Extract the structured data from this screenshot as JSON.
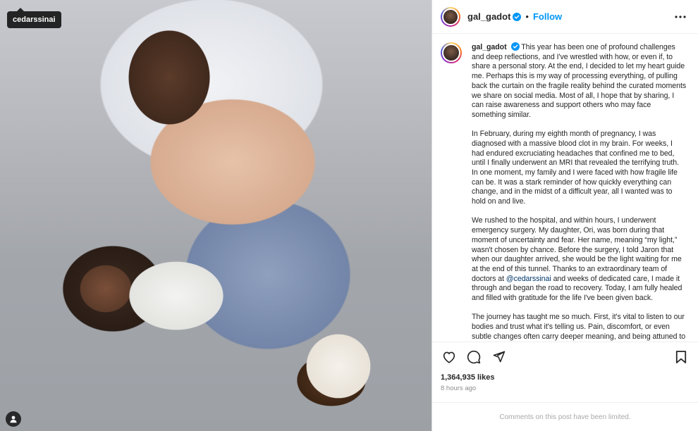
{
  "media": {
    "tag_label": "cedarssinai"
  },
  "header": {
    "username": "gal_gadot",
    "separator": "•",
    "follow_label": "Follow"
  },
  "caption": {
    "username": "gal_gadot",
    "p1": "This year has been one of profound challenges and deep reflections, and I've wrestled with how, or even if, to share a personal story. At the end, I decided to let my heart guide me. Perhaps this is my way of processing everything, of pulling back the curtain on the fragile reality behind the curated moments we share on social media. Most of all, I hope that by sharing, I can raise awareness and support others who may face something similar.",
    "p2": "In February, during my eighth month of pregnancy, I was diagnosed with a massive blood clot in my brain. For weeks, I had endured excruciating headaches that confined me to bed, until I finally underwent an MRI that revealed the terrifying truth. In one moment, my family and I were faced with how fragile life can be. It was a stark reminder of how quickly everything can change, and in the midst of a difficult year, all I wanted was to hold on and live.",
    "p3a": "We rushed to the hospital, and within hours, I underwent emergency surgery. My daughter, Ori, was born during that moment of uncertainty and fear. Her name, meaning “my light,” wasn't chosen by chance. Before the surgery, I told Jaron that when our daughter arrived, she would be the light waiting for me at the end of this tunnel. Thanks to an extraordinary team of doctors at ",
    "p3_mention": "@cedarssinai",
    "p3b": " and weeks of dedicated care, I made it through and began the road to recovery. Today, I am fully healed and filled with gratitude for the life I've been given back.",
    "p4": "The journey has taught me so much. First, it's vital to listen to our bodies and trust what it's telling us. Pain, discomfort, or even subtle changes often carry deeper meaning, and being attuned to your body can be life saving."
  },
  "stats": {
    "likes": "1,364,935 likes",
    "time": "8 hours ago"
  },
  "comments": {
    "limited_text": "Comments on this post have been limited."
  },
  "icons": {
    "verified": "verified-badge-icon",
    "more": "more-options-icon",
    "like": "heart-icon",
    "comment": "comment-icon",
    "share": "share-icon",
    "save": "bookmark-icon",
    "user_tag": "person-icon"
  },
  "colors": {
    "follow": "#0095f6",
    "verified": "#0095f6",
    "muted": "#8e8e8e"
  }
}
